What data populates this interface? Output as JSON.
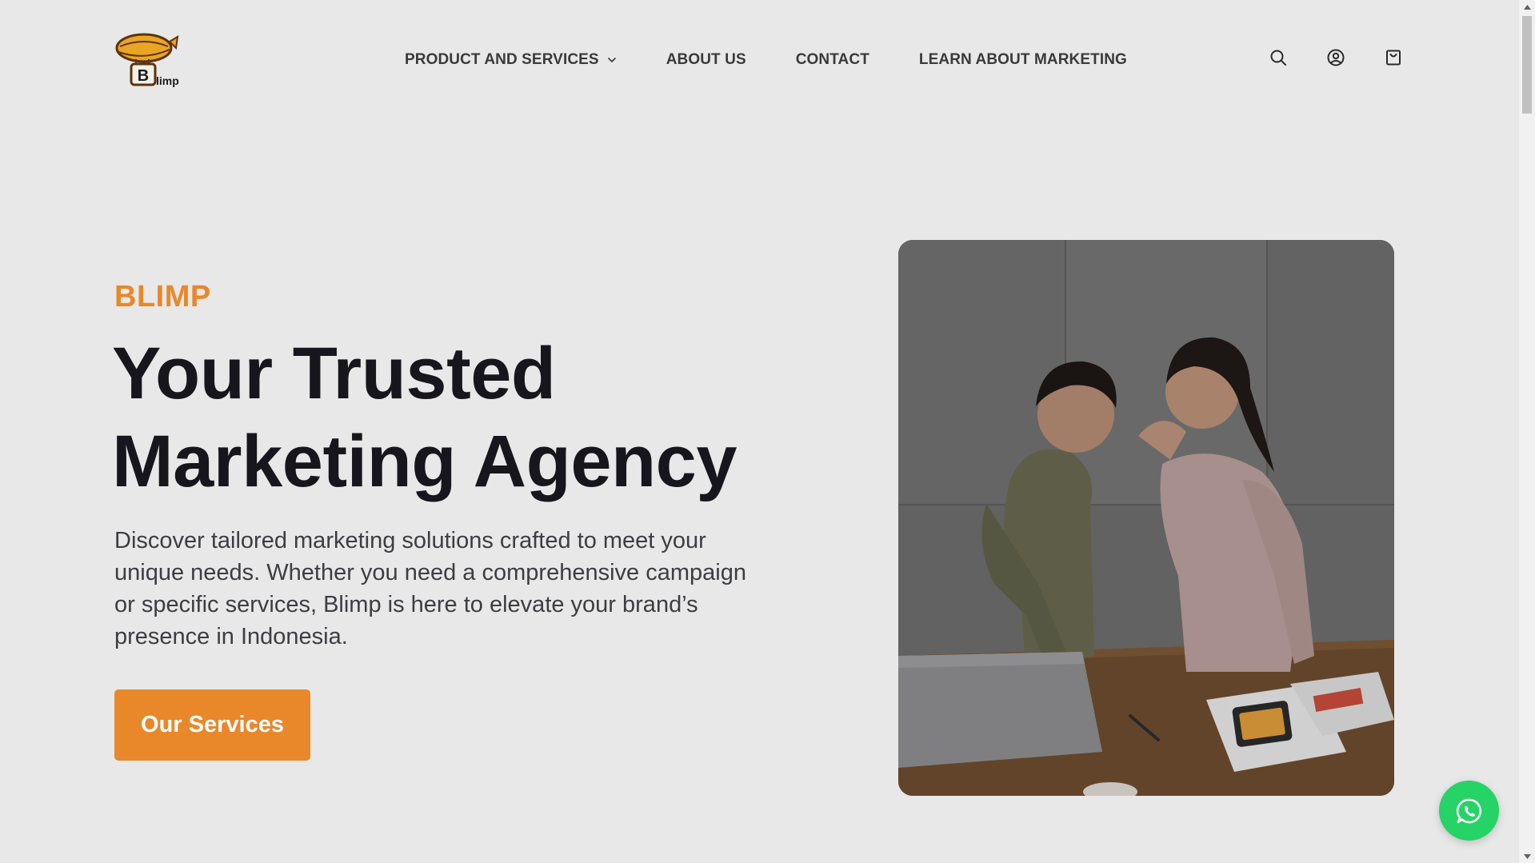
{
  "brand": {
    "logo_text": "Blimp",
    "logo_badge_letter": "B"
  },
  "nav": {
    "items": [
      {
        "label": "PRODUCT AND SERVICES",
        "has_dropdown": true
      },
      {
        "label": "ABOUT US"
      },
      {
        "label": "CONTACT"
      },
      {
        "label": "LEARN ABOUT MARKETING"
      }
    ]
  },
  "header_icons": [
    "search-icon",
    "account-icon",
    "shopping-bag-icon"
  ],
  "hero": {
    "eyebrow": "BLIMP",
    "headline_line1": "Your Trusted",
    "headline_line2": "Marketing Agency",
    "lead": "Discover tailored marketing solutions crafted to meet your unique needs. Whether you need a comprehensive campaign or specific services, Blimp is here to elevate your brand’s presence in Indonesia.",
    "cta_label": "Our Services",
    "image_icon": "team-photo"
  },
  "floating": {
    "whatsapp_icon": "whatsapp-icon"
  },
  "colors": {
    "accent": "#e8882a",
    "background": "#e8e8e8",
    "heading": "#17161c",
    "body_text": "#3d3d42",
    "whatsapp": "#25d366"
  }
}
